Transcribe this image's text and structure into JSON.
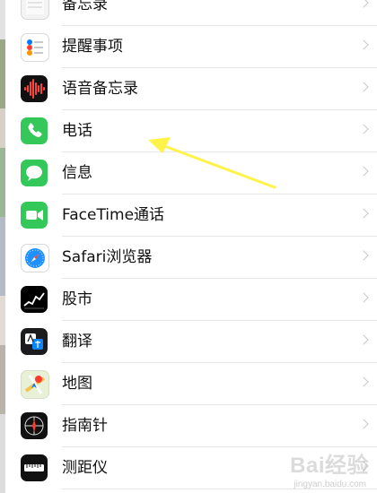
{
  "settings": {
    "items": [
      {
        "label": "备忘录",
        "icon": "notes-icon"
      },
      {
        "label": "提醒事项",
        "icon": "reminders-icon"
      },
      {
        "label": "语音备忘录",
        "icon": "voice-memos-icon"
      },
      {
        "label": "电话",
        "icon": "phone-icon"
      },
      {
        "label": "信息",
        "icon": "messages-icon"
      },
      {
        "label": "FaceTime通话",
        "icon": "facetime-icon"
      },
      {
        "label": "Safari浏览器",
        "icon": "safari-icon"
      },
      {
        "label": "股市",
        "icon": "stocks-icon"
      },
      {
        "label": "翻译",
        "icon": "translate-icon"
      },
      {
        "label": "地图",
        "icon": "maps-icon"
      },
      {
        "label": "指南针",
        "icon": "compass-icon"
      },
      {
        "label": "测距仪",
        "icon": "measure-icon"
      }
    ]
  },
  "annotation": {
    "color": "#fff34a",
    "target": "电话"
  },
  "watermark": {
    "brand": "Bai经验",
    "site": "jingyan.baidu.com"
  },
  "colors": {
    "chevron": "#c7c7cc",
    "divider": "#e5e5ea",
    "app_green": "#34c759"
  }
}
